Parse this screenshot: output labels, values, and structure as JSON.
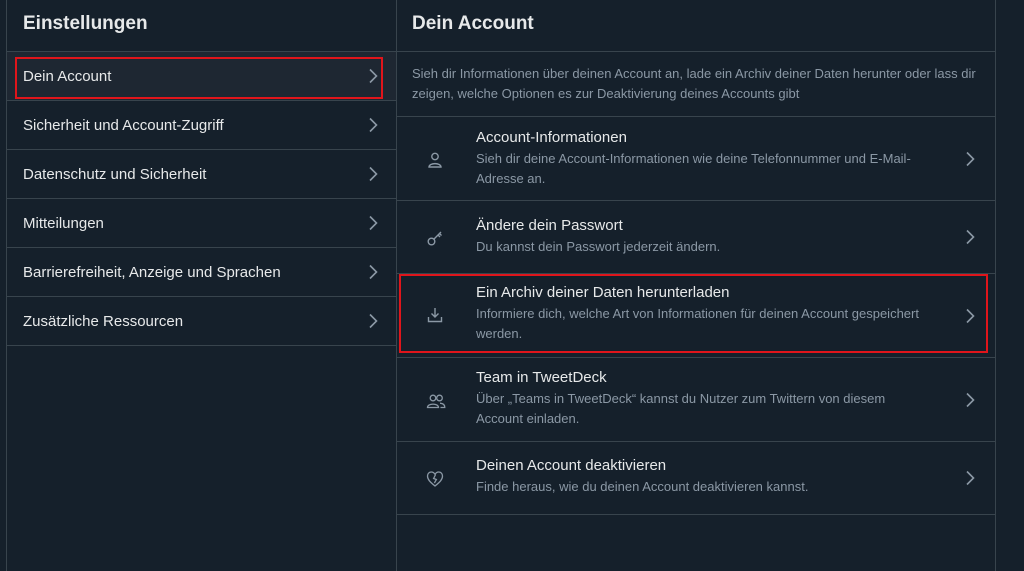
{
  "left": {
    "title": "Einstellungen",
    "items": [
      {
        "label": "Dein Account"
      },
      {
        "label": "Sicherheit und Account-Zugriff"
      },
      {
        "label": "Datenschutz und Sicherheit"
      },
      {
        "label": "Mitteilungen"
      },
      {
        "label": "Barrierefreiheit, Anzeige und Sprachen"
      },
      {
        "label": "Zusätzliche Ressourcen"
      }
    ]
  },
  "right": {
    "title": "Dein Account",
    "description": "Sieh dir Informationen über deinen Account an, lade ein Archiv deiner Daten herunter oder lass dir zeigen, welche Optionen es zur Deaktivierung deines Accounts gibt",
    "options": [
      {
        "title": "Account-Informationen",
        "subtitle": "Sieh dir deine Account-Informationen wie deine Telefonnummer und E-Mail-Adresse an.",
        "icon": "person-icon"
      },
      {
        "title": "Ändere dein Passwort",
        "subtitle": "Du kannst dein Passwort jederzeit ändern.",
        "icon": "key-icon"
      },
      {
        "title": "Ein Archiv deiner Daten herunterladen",
        "subtitle": "Informiere dich, welche Art von Informationen für deinen Account gespeichert werden.",
        "icon": "download-icon"
      },
      {
        "title": "Team in TweetDeck",
        "subtitle": "Über „Teams in TweetDeck“ kannst du Nutzer zum Twittern von diesem Account einladen.",
        "icon": "people-icon"
      },
      {
        "title": "Deinen Account deaktivieren",
        "subtitle": "Finde heraus, wie du deinen Account deaktivieren kannst.",
        "icon": "broken-heart-icon"
      }
    ]
  },
  "colors": {
    "background": "#15202b",
    "border": "#38444d",
    "accent": "#1d9bf0",
    "highlight": "#e0151b"
  }
}
